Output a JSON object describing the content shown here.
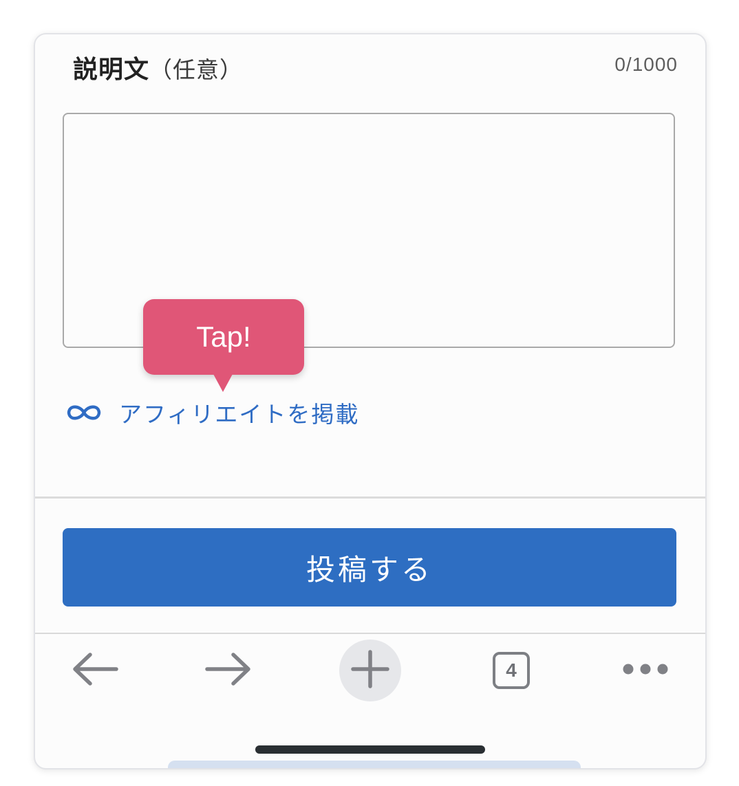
{
  "description": {
    "title": "説明文",
    "optional": "（任意）",
    "char_count": "0/1000",
    "text_value": ""
  },
  "tooltip": {
    "text": "Tap!"
  },
  "affiliate": {
    "icon": "infinity-link-icon",
    "label": "アフィリエイトを掲載"
  },
  "submit": {
    "label": "投稿する"
  },
  "toolbar": {
    "back_icon": "arrow-left-icon",
    "forward_icon": "arrow-right-icon",
    "new_tab_icon": "plus-icon",
    "tab_count": "4",
    "more_icon": "more-dots-icon"
  },
  "colors": {
    "accent": "#2e6ec2",
    "link": "#2f6cc4",
    "tooltip": "#e05677"
  }
}
